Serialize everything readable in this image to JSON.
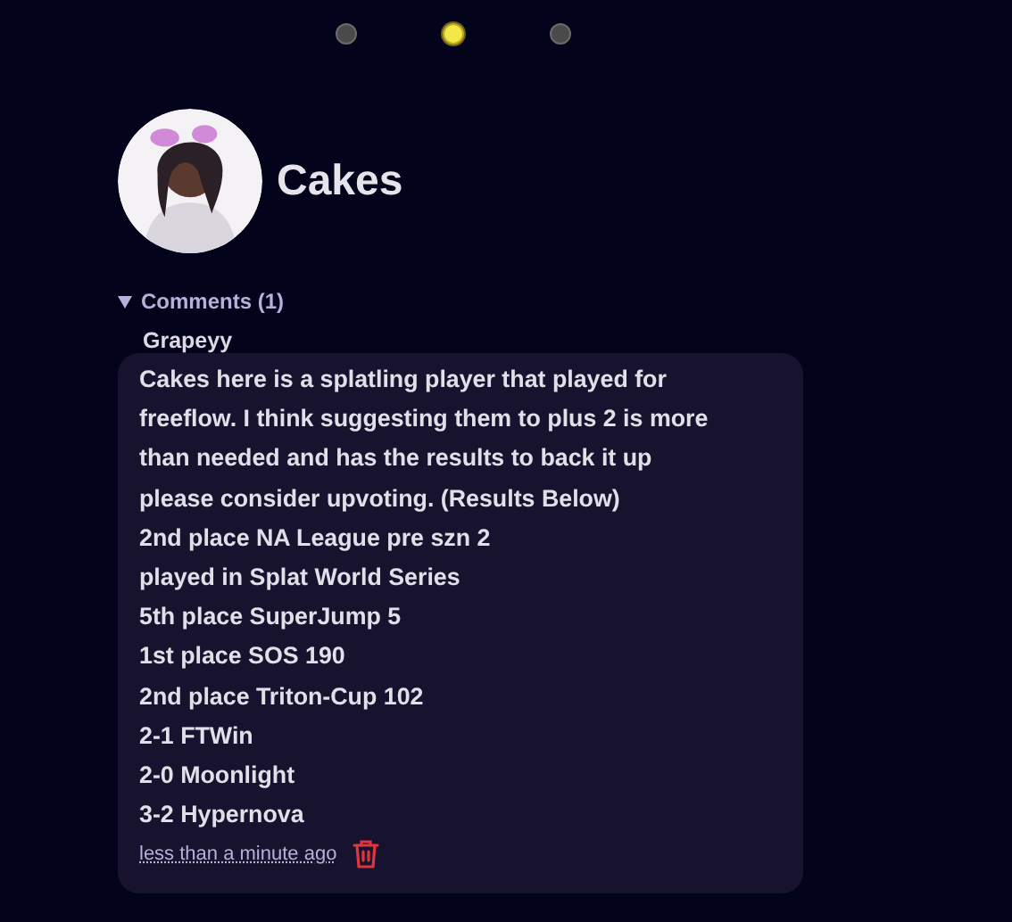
{
  "tiers": [
    {
      "selected": false
    },
    {
      "selected": true
    },
    {
      "selected": false
    }
  ],
  "profile": {
    "name": "Cakes"
  },
  "comments": {
    "summary": "Comments (1)",
    "expanded": true,
    "items": [
      {
        "author": "Grapeyy",
        "body": "Cakes here is a splatling player that played for\nfreeflow. I think suggesting them to plus 2 is more\nthan needed and has the results to back it up\nplease consider upvoting. (Results Below)\n2nd place NA League pre szn 2\nplayed in Splat World Series\n5th place SuperJump 5\n1st place SOS 190\n2nd place Triton-Cup 102\n2-1 FTWin\n2-0 Moonlight\n3-2 Hypernova",
        "time": "less than a minute ago"
      }
    ]
  }
}
